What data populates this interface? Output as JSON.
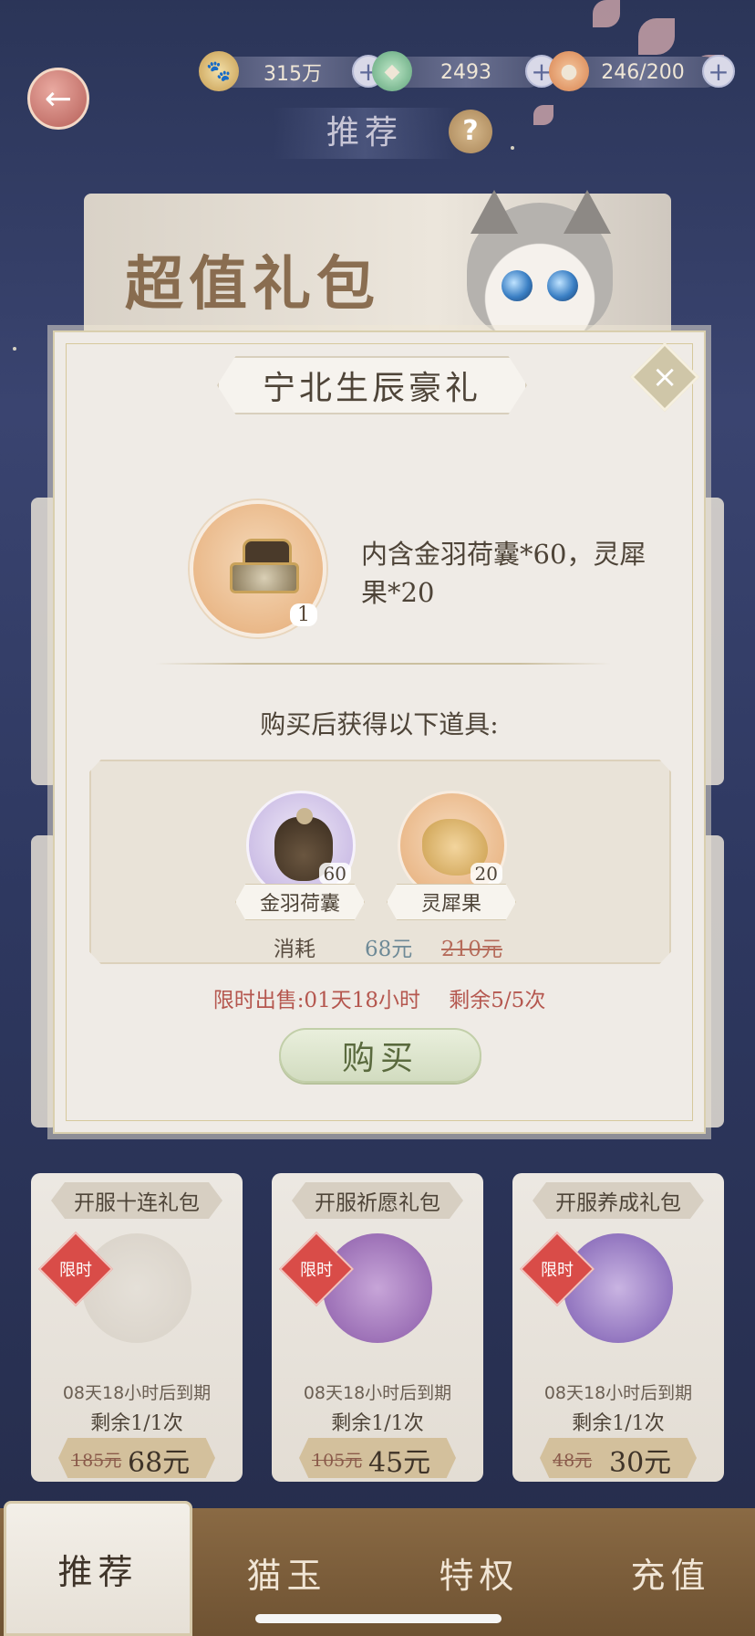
{
  "header": {
    "title": "推荐",
    "currencies": [
      {
        "icon": "paw-coin-icon",
        "value": "315万"
      },
      {
        "icon": "green-gem-icon",
        "value": "2493"
      },
      {
        "icon": "food-bowl-icon",
        "value": "246/200"
      }
    ],
    "plus": "+"
  },
  "banner": {
    "title": "超值礼包"
  },
  "modal": {
    "title": "宁北生辰豪礼",
    "main_item": {
      "count": "1",
      "description": "内含金羽荷囊*60，灵犀果*20"
    },
    "after_title": "购买后获得以下道具:",
    "rewards": [
      {
        "name": "金羽荷囊",
        "count": "60"
      },
      {
        "name": "灵犀果",
        "count": "20"
      }
    ],
    "cost_label": "消耗",
    "price_now": "68元",
    "price_old": "210元",
    "limit_text": "限时出售:01天18小时",
    "remain_text": "剩余5/5次",
    "buy_label": "购买"
  },
  "packs": [
    {
      "title": "开服十连礼包",
      "badge": "限时",
      "expire": "08天18小时后到期",
      "remain": "剩余1/1次",
      "old_price": "185元",
      "price": "68元"
    },
    {
      "title": "开服祈愿礼包",
      "badge": "限时",
      "expire": "08天18小时后到期",
      "remain": "剩余1/1次",
      "old_price": "105元",
      "price": "45元"
    },
    {
      "title": "开服养成礼包",
      "badge": "限时",
      "expire": "08天18小时后到期",
      "remain": "剩余1/1次",
      "old_price": "48元",
      "price": "30元"
    }
  ],
  "tabs": [
    {
      "label": "推荐"
    },
    {
      "label": "猫玉"
    },
    {
      "label": "特权"
    },
    {
      "label": "充值"
    }
  ],
  "colors": {
    "accent_red": "#b5574f",
    "tab_bar": "#7a5c3a",
    "modal_bg": "#efebe6"
  }
}
